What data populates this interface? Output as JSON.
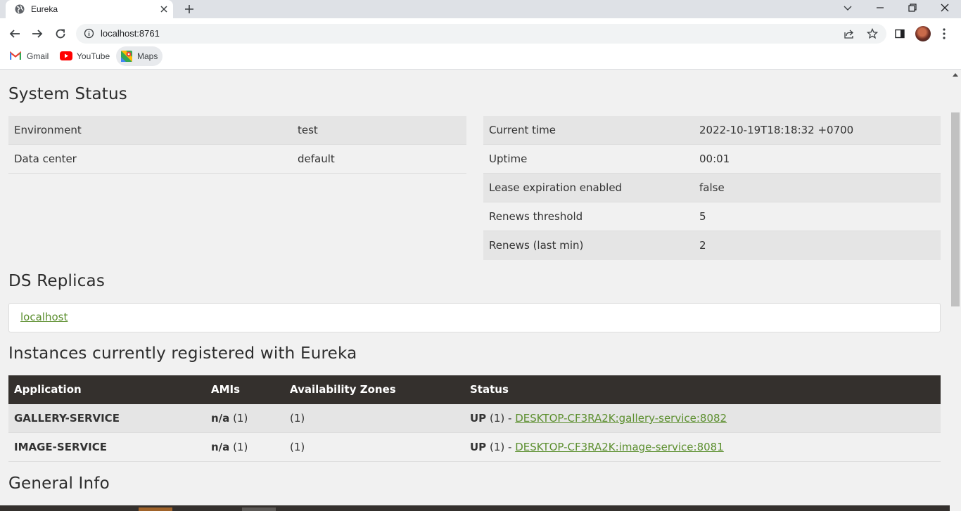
{
  "browser": {
    "tab_title": "Eureka",
    "url": "localhost:8761",
    "bookmarks": [
      {
        "label": "Gmail",
        "icon": "gmail-icon"
      },
      {
        "label": "YouTube",
        "icon": "youtube-icon"
      },
      {
        "label": "Maps",
        "icon": "maps-icon"
      }
    ]
  },
  "system_status": {
    "title": "System Status",
    "left": [
      {
        "key": "Environment",
        "value": "test"
      },
      {
        "key": "Data center",
        "value": "default"
      }
    ],
    "right": [
      {
        "key": "Current time",
        "value": "2022-10-19T18:18:32 +0700"
      },
      {
        "key": "Uptime",
        "value": "00:01"
      },
      {
        "key": "Lease expiration enabled",
        "value": "false"
      },
      {
        "key": "Renews threshold",
        "value": "5"
      },
      {
        "key": "Renews (last min)",
        "value": "2"
      }
    ]
  },
  "ds_replicas": {
    "title": "DS Replicas",
    "items": [
      "localhost"
    ]
  },
  "instances": {
    "title": "Instances currently registered with Eureka",
    "columns": [
      "Application",
      "AMIs",
      "Availability Zones",
      "Status"
    ],
    "rows": [
      {
        "application": "GALLERY-SERVICE",
        "amis_label": "n/a",
        "amis_count": "(1)",
        "zones": "(1)",
        "status": "UP",
        "status_count": "(1) -",
        "instance": "DESKTOP-CF3RA2K:gallery-service:8082"
      },
      {
        "application": "IMAGE-SERVICE",
        "amis_label": "n/a",
        "amis_count": "(1)",
        "zones": "(1)",
        "status": "UP",
        "status_count": "(1) -",
        "instance": "DESKTOP-CF3RA2K:image-service:8081"
      }
    ]
  },
  "general_info": {
    "title": "General Info"
  },
  "colors": {
    "header_bg": "#34302d",
    "link": "#5c8f2f",
    "row_shade": "#e5e5e5"
  }
}
